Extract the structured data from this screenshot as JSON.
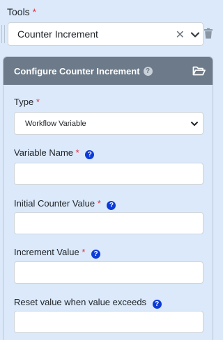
{
  "tools": {
    "label": "Tools",
    "required_mark": "*",
    "selected": "Counter Increment",
    "clear_glyph": "✕"
  },
  "card": {
    "title": "Configure Counter Increment",
    "help_glyph": "?",
    "icon": "folder-open-icon"
  },
  "fields": {
    "type": {
      "label": "Type",
      "required_mark": "*",
      "value": "Workflow Variable"
    },
    "variable_name": {
      "label": "Variable Name",
      "required_mark": "*",
      "help_glyph": "?",
      "value": ""
    },
    "initial_counter_value": {
      "label": "Initial Counter Value",
      "required_mark": "*",
      "help_glyph": "?",
      "value": ""
    },
    "increment_value": {
      "label": "Increment Value",
      "required_mark": "*",
      "help_glyph": "?",
      "value": ""
    },
    "reset_value": {
      "label": "Reset value when value exceeds",
      "help_glyph": "?",
      "value": ""
    }
  },
  "colors": {
    "background": "#dbe9fa",
    "header": "#6c7a89",
    "required": "#dc3545",
    "help_icon": "#0d3bd8"
  }
}
